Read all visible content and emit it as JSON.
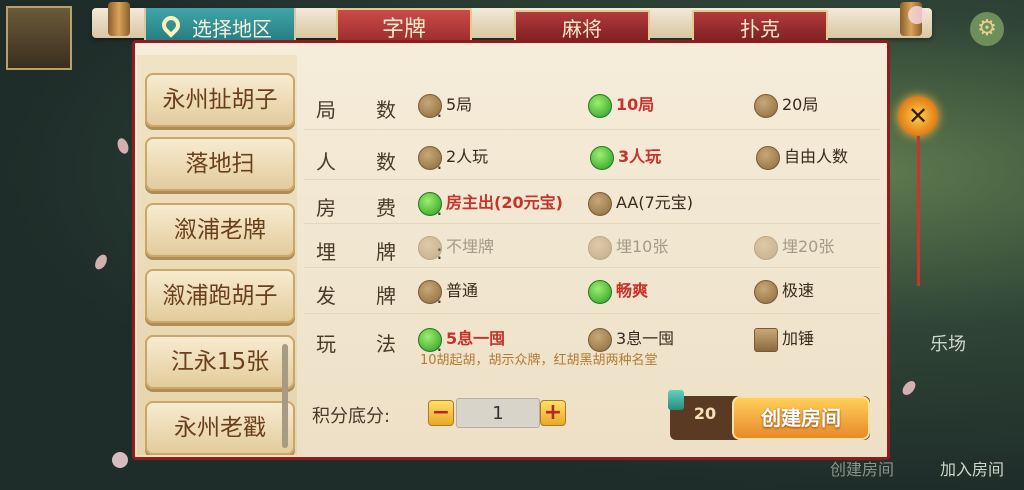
{
  "region_selector": {
    "label": "选择地区"
  },
  "tabs": [
    {
      "label": "字牌",
      "active": true
    },
    {
      "label": "麻将",
      "active": false
    },
    {
      "label": "扑克",
      "active": false
    }
  ],
  "regions": [
    "永州扯胡子",
    "落地扫",
    "溆浦老牌",
    "溆浦跑胡子",
    "江永15张",
    "永州老戳"
  ],
  "options": {
    "rounds": {
      "label": "局数",
      "choices": [
        {
          "text": "5局",
          "selected": false
        },
        {
          "text": "10局",
          "selected": true
        },
        {
          "text": "20局",
          "selected": false
        }
      ]
    },
    "players": {
      "label": "人数",
      "choices": [
        {
          "text": "2人玩",
          "selected": false
        },
        {
          "text": "3人玩",
          "selected": true
        },
        {
          "text": "自由人数",
          "selected": false
        }
      ]
    },
    "fee": {
      "label": "房费",
      "choices": [
        {
          "text": "房主出(20元宝)",
          "selected": true
        },
        {
          "text": "AA(7元宝)",
          "selected": false
        }
      ]
    },
    "bury": {
      "label": "埋牌",
      "choices": [
        {
          "text": "不埋牌",
          "selected": false,
          "disabled": true
        },
        {
          "text": "埋10张",
          "selected": false,
          "disabled": true
        },
        {
          "text": "埋20张",
          "selected": false,
          "disabled": true
        }
      ]
    },
    "deal": {
      "label": "发牌",
      "choices": [
        {
          "text": "普通",
          "selected": false
        },
        {
          "text": "畅爽",
          "selected": true
        },
        {
          "text": "极速",
          "selected": false
        }
      ]
    },
    "play": {
      "label": "玩法",
      "choices": [
        {
          "text": "5息一囤",
          "selected": true
        },
        {
          "text": "3息一囤",
          "selected": false
        },
        {
          "text": "加锤",
          "selected": false,
          "checkbox": true
        }
      ],
      "note": "10胡起胡，胡示众牌，红胡黑胡两种名堂"
    }
  },
  "score": {
    "label": "积分底分:",
    "value": "1",
    "minus": "−",
    "plus": "+"
  },
  "create": {
    "cost": "20",
    "label": "创建房间"
  },
  "close_label": "✕",
  "background": {
    "gear": "⚙",
    "lobby_label": "乐场",
    "join_room": "加入房间",
    "create_room": "创建房间"
  }
}
